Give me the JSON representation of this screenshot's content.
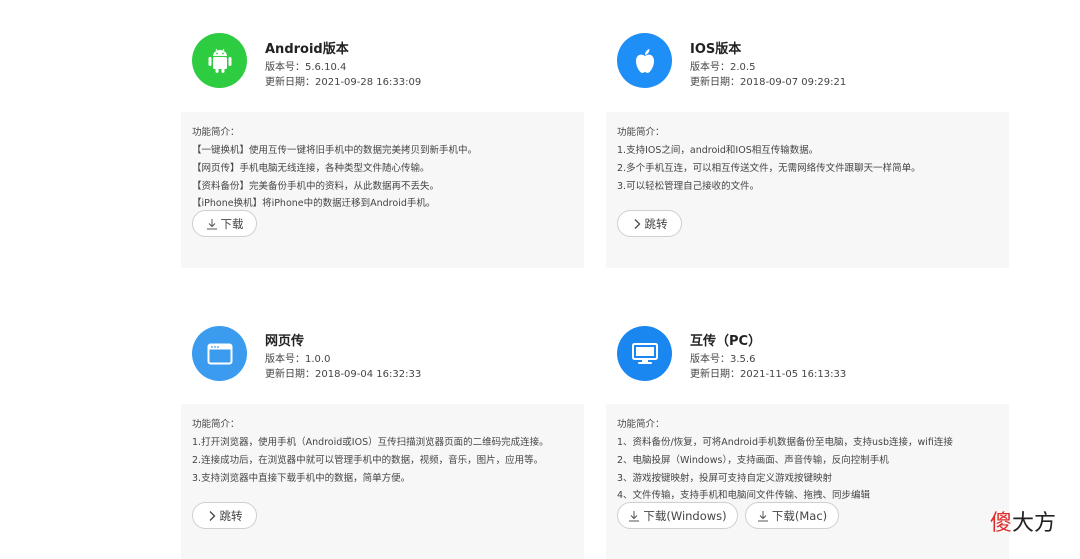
{
  "colors": {
    "android": "#2ecc40",
    "ios": "#1e8ff7",
    "web": "#3a9bef",
    "pc": "#1a86f0"
  },
  "cards": [
    {
      "title": "Android版本",
      "version": "版本号：5.6.10.4",
      "date": "更新日期：2021-09-28 16:33:09",
      "intro": "功能简介：",
      "lines": [
        "【一键换机】使用互传一键将旧手机中的数据完美拷贝到新手机中。",
        "【网页传】手机电脑无线连接，各种类型文件随心传输。",
        "【资料备份】完美备份手机中的资料，从此数据再不丢失。",
        "【iPhone换机】将iPhone中的数据迁移到Android手机。"
      ],
      "buttons": [
        "下载"
      ]
    },
    {
      "title": "IOS版本",
      "version": "版本号：2.0.5",
      "date": "更新日期：2018-09-07 09:29:21",
      "intro": "功能简介：",
      "lines": [
        "1.支持IOS之间，android和IOS相互传输数据。",
        "2.多个手机互连，可以相互传送文件，无需网络传文件跟聊天一样简单。",
        "3.可以轻松管理自己接收的文件。"
      ],
      "buttons": [
        "跳转"
      ]
    },
    {
      "title": "网页传",
      "version": "版本号：1.0.0",
      "date": "更新日期：2018-09-04 16:32:33",
      "intro": "功能简介：",
      "lines": [
        "1.打开浏览器，使用手机（Android或IOS）互传扫描浏览器页面的二维码完成连接。",
        "2.连接成功后，在浏览器中就可以管理手机中的数据，视频，音乐，图片，应用等。",
        "3.支持浏览器中直接下载手机中的数据，简单方便。"
      ],
      "buttons": [
        "跳转"
      ]
    },
    {
      "title": "互传（PC）",
      "version": "版本号：3.5.6",
      "date": "更新日期：2021-11-05 16:13:33",
      "intro": "功能简介：",
      "lines": [
        "1、资料备份/恢复，可将Android手机数据备份至电脑，支持usb连接，wifi连接",
        "2、电脑投屏（Windows），支持画面、声音传输，反向控制手机",
        "3、游戏按键映射，投屏可支持自定义游戏按键映射",
        "4、文件传输，支持手机和电脑间文件传输、拖拽、同步编辑"
      ],
      "buttons": [
        "下载(Windows)",
        "下载(Mac)"
      ]
    }
  ],
  "watermark": {
    "red": "傻",
    "black": "大方"
  }
}
